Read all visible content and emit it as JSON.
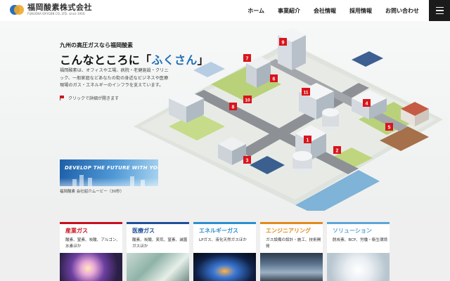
{
  "header": {
    "logo_jp": "福岡酸素株式会社",
    "logo_en": "FUKUOKA OXYGEN CO.,LTD. since 1916",
    "nav": [
      {
        "label": "ホーム"
      },
      {
        "label": "事業紹介"
      },
      {
        "label": "会社情報"
      },
      {
        "label": "採用情報"
      },
      {
        "label": "お問い合わせ"
      }
    ]
  },
  "hero": {
    "subtitle": "九州の高圧ガスなら福岡酸素",
    "title_pre": "こんなところに「",
    "title_highlight": "ふくさん",
    "title_post": "」",
    "description": "福岡酸素は、オフィスや工場、病院・老健施設・クリニック、一般家庭などあなたの街の身近なビジネスや医療現場のガス・エネルギーのインフラを支えています。",
    "click_hint": "クリックで詳細が開きます",
    "video_text": "DEVELOP THE FUTURE WITH YOU",
    "video_caption": "福岡酸素 会社紹介ムービー（30秒）",
    "markers": [
      "1",
      "2",
      "3",
      "4",
      "5",
      "6",
      "7",
      "8",
      "9",
      "10",
      "11"
    ]
  },
  "colors": {
    "accent_blue": "#2270b8",
    "marker_red": "#d9141c",
    "industrial": "#c8101e",
    "medical": "#1f4f9c",
    "energy": "#2b8fd0",
    "engineering": "#e28a1d",
    "solution": "#5aa6d8"
  },
  "services": [
    {
      "title": "産業ガス",
      "desc": "酸素、窒素、炭酸、アルゴン、水素ほか",
      "color": "#c8101e",
      "photo": "welding-sparks"
    },
    {
      "title": "医療ガス",
      "desc": "酸素、炭酸、笑気、窒素、滅菌ガスほか",
      "color": "#1f4f9c",
      "photo": "medical-lab"
    },
    {
      "title": "エネルギーガス",
      "desc": "LPガス、液化天然ガスほか",
      "color": "#2b8fd0",
      "photo": "gas-flame"
    },
    {
      "title": "エンジニアリング",
      "desc": "ガス設備の設計・施工、技術開発",
      "color": "#e28a1d",
      "photo": "control-monitors"
    },
    {
      "title": "ソリューション",
      "desc": "脱炭素、BCP、労働・衛生環境",
      "color": "#5aa6d8",
      "photo": "dry-ice"
    }
  ]
}
